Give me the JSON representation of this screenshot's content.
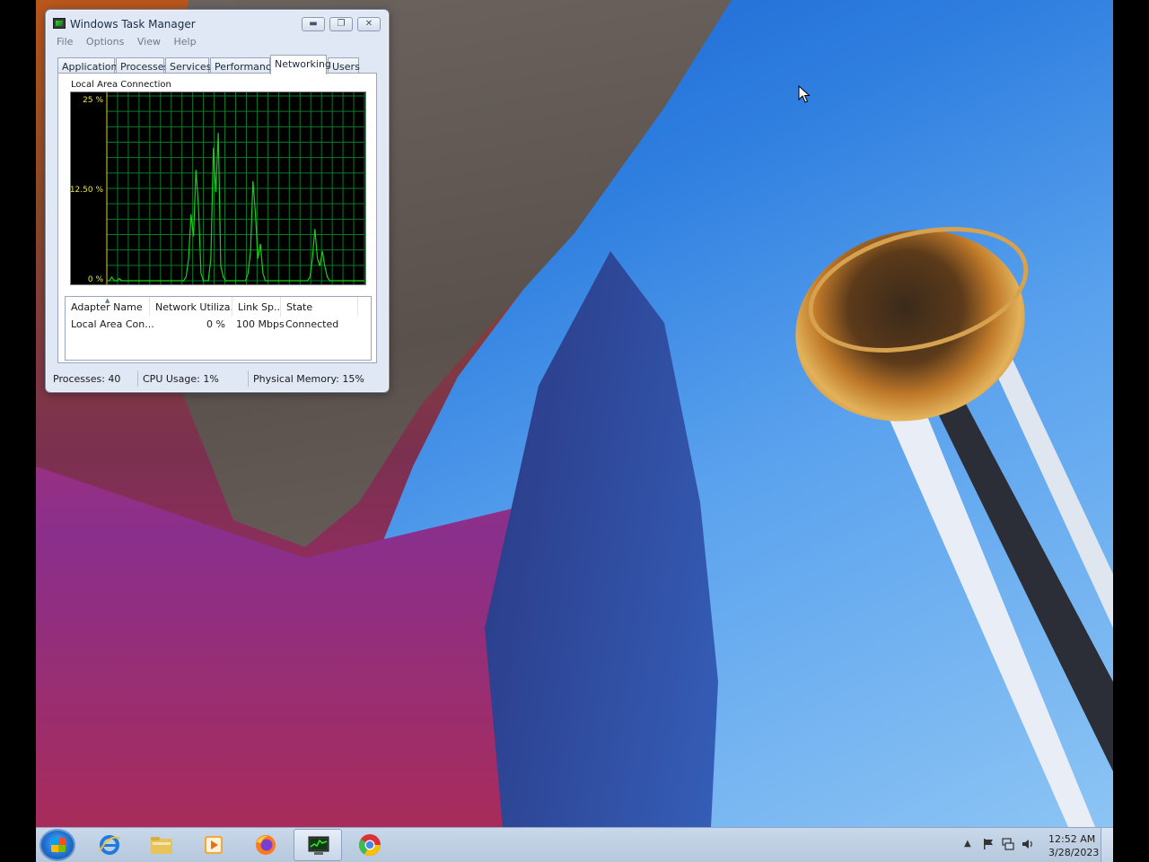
{
  "window": {
    "title": "Windows Task Manager",
    "menu": [
      "File",
      "Options",
      "View",
      "Help"
    ],
    "tabs": [
      {
        "label": "Applications",
        "active": false
      },
      {
        "label": "Processes",
        "active": false
      },
      {
        "label": "Services",
        "active": false
      },
      {
        "label": "Performance",
        "active": false
      },
      {
        "label": "Networking",
        "active": true
      },
      {
        "label": "Users",
        "active": false
      }
    ]
  },
  "networking": {
    "graph_title": "Local Area Connection",
    "y_ticks": [
      "25 %",
      "12.50 %",
      "0 %"
    ],
    "graph_colors": {
      "line": "#16d016",
      "grid": "#0c7a2c",
      "y_axis": "#d8d82a",
      "background": "#000000"
    },
    "table": {
      "headers": [
        "Adapter Name",
        "Network Utiliza...",
        "Link Sp...",
        "State"
      ],
      "rows": [
        {
          "adapter": "Local Area Con...",
          "utilization": "0 %",
          "link_speed": "100 Mbps",
          "state": "Connected"
        }
      ]
    }
  },
  "chart_data": {
    "type": "line",
    "title": "Local Area Connection",
    "ylim": [
      0,
      25
    ],
    "yticks": [
      0,
      12.5,
      25
    ],
    "grid": true,
    "series": [
      {
        "values": [
          0,
          0,
          0.5,
          0,
          0,
          0.3,
          0,
          0,
          0,
          0,
          0,
          0,
          0,
          0,
          0,
          0,
          0,
          0,
          0,
          0,
          0,
          0,
          0,
          0,
          0,
          0,
          0,
          0,
          0,
          0,
          0,
          0,
          0.5,
          3,
          9,
          6,
          15,
          10,
          1,
          0,
          0,
          0,
          3,
          18,
          12,
          20,
          2,
          0.5,
          0,
          0,
          0,
          0,
          0,
          0,
          0,
          0,
          0,
          1,
          4,
          13.5,
          9,
          3,
          5,
          1,
          0,
          0,
          0,
          0,
          0,
          0,
          0,
          0,
          0,
          0,
          0,
          0,
          0,
          0,
          0,
          0,
          0,
          0,
          0.5,
          3,
          7,
          3,
          2,
          4,
          2,
          0.5,
          0,
          0,
          0,
          0,
          0,
          0,
          0,
          0,
          0,
          0,
          0,
          0,
          0,
          0,
          0
        ]
      }
    ]
  },
  "status": {
    "processes": "Processes: 40",
    "cpu": "CPU Usage: 1%",
    "memory": "Physical Memory: 15%"
  },
  "taskbar": {
    "apps": [
      {
        "name": "internet-explorer",
        "active": false
      },
      {
        "name": "file-explorer",
        "active": false
      },
      {
        "name": "media-player",
        "active": false
      },
      {
        "name": "firefox",
        "active": false
      },
      {
        "name": "task-manager",
        "active": true
      },
      {
        "name": "chrome",
        "active": false
      }
    ],
    "clock": {
      "time": "12:52 AM",
      "date": "3/28/2023"
    }
  }
}
